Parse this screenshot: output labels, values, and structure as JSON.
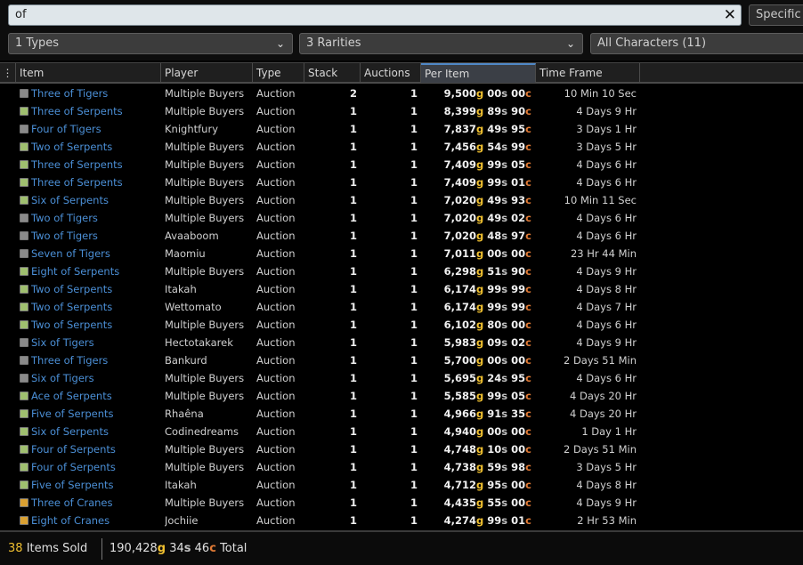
{
  "search": {
    "value": "of",
    "specific_label": "Specific"
  },
  "filters": {
    "types": "1 Types",
    "rarities": "3 Rarities",
    "characters": "All Characters (11)"
  },
  "columns": {
    "menu": "⋮",
    "item": "Item",
    "player": "Player",
    "type": "Type",
    "stack": "Stack",
    "auctions": "Auctions",
    "per_item": "Per Item",
    "time_frame": "Time Frame"
  },
  "rows": [
    {
      "item": "Three of Tigers",
      "player": "Multiple Buyers",
      "type": "Auction",
      "stack": "2",
      "auctions": "1",
      "g": "9,500",
      "s": "00",
      "c": "00",
      "time": "10 Min 10 Sec",
      "icon_color": "#8a8a8a"
    },
    {
      "item": "Three of Serpents",
      "player": "Multiple Buyers",
      "type": "Auction",
      "stack": "1",
      "auctions": "1",
      "g": "8,399",
      "s": "89",
      "c": "90",
      "time": "4 Days 9 Hr",
      "icon_color": "#9fbf6f"
    },
    {
      "item": "Four of Tigers",
      "player": "Knightfury",
      "type": "Auction",
      "stack": "1",
      "auctions": "1",
      "g": "7,837",
      "s": "49",
      "c": "95",
      "time": "3 Days 1 Hr",
      "icon_color": "#8a8a8a"
    },
    {
      "item": "Two of Serpents",
      "player": "Multiple Buyers",
      "type": "Auction",
      "stack": "1",
      "auctions": "1",
      "g": "7,456",
      "s": "54",
      "c": "99",
      "time": "3 Days 5 Hr",
      "icon_color": "#9fbf6f"
    },
    {
      "item": "Three of Serpents",
      "player": "Multiple Buyers",
      "type": "Auction",
      "stack": "1",
      "auctions": "1",
      "g": "7,409",
      "s": "99",
      "c": "05",
      "time": "4 Days 6 Hr",
      "icon_color": "#9fbf6f"
    },
    {
      "item": "Three of Serpents",
      "player": "Multiple Buyers",
      "type": "Auction",
      "stack": "1",
      "auctions": "1",
      "g": "7,409",
      "s": "99",
      "c": "01",
      "time": "4 Days 6 Hr",
      "icon_color": "#9fbf6f"
    },
    {
      "item": "Six of Serpents",
      "player": "Multiple Buyers",
      "type": "Auction",
      "stack": "1",
      "auctions": "1",
      "g": "7,020",
      "s": "49",
      "c": "93",
      "time": "10 Min 11 Sec",
      "icon_color": "#9fbf6f"
    },
    {
      "item": "Two of Tigers",
      "player": "Multiple Buyers",
      "type": "Auction",
      "stack": "1",
      "auctions": "1",
      "g": "7,020",
      "s": "49",
      "c": "02",
      "time": "4 Days 6 Hr",
      "icon_color": "#8a8a8a"
    },
    {
      "item": "Two of Tigers",
      "player": "Avaaboom",
      "type": "Auction",
      "stack": "1",
      "auctions": "1",
      "g": "7,020",
      "s": "48",
      "c": "97",
      "time": "4 Days 6 Hr",
      "icon_color": "#8a8a8a"
    },
    {
      "item": "Seven of Tigers",
      "player": "Maomiu",
      "type": "Auction",
      "stack": "1",
      "auctions": "1",
      "g": "7,011",
      "s": "00",
      "c": "00",
      "time": "23 Hr 44 Min",
      "icon_color": "#8a8a8a"
    },
    {
      "item": "Eight of Serpents",
      "player": "Multiple Buyers",
      "type": "Auction",
      "stack": "1",
      "auctions": "1",
      "g": "6,298",
      "s": "51",
      "c": "90",
      "time": "4 Days 9 Hr",
      "icon_color": "#9fbf6f"
    },
    {
      "item": "Two of Serpents",
      "player": "Itakah",
      "type": "Auction",
      "stack": "1",
      "auctions": "1",
      "g": "6,174",
      "s": "99",
      "c": "99",
      "time": "4 Days 8 Hr",
      "icon_color": "#9fbf6f"
    },
    {
      "item": "Two of Serpents",
      "player": "Wettomato",
      "type": "Auction",
      "stack": "1",
      "auctions": "1",
      "g": "6,174",
      "s": "99",
      "c": "99",
      "time": "4 Days 7 Hr",
      "icon_color": "#9fbf6f"
    },
    {
      "item": "Two of Serpents",
      "player": "Multiple Buyers",
      "type": "Auction",
      "stack": "1",
      "auctions": "1",
      "g": "6,102",
      "s": "80",
      "c": "00",
      "time": "4 Days 6 Hr",
      "icon_color": "#9fbf6f"
    },
    {
      "item": "Six of Tigers",
      "player": "Hectotakarek",
      "type": "Auction",
      "stack": "1",
      "auctions": "1",
      "g": "5,983",
      "s": "09",
      "c": "02",
      "time": "4 Days 9 Hr",
      "icon_color": "#8a8a8a"
    },
    {
      "item": "Three of Tigers",
      "player": "Bankurd",
      "type": "Auction",
      "stack": "1",
      "auctions": "1",
      "g": "5,700",
      "s": "00",
      "c": "00",
      "time": "2 Days 51 Min",
      "icon_color": "#8a8a8a"
    },
    {
      "item": "Six of Tigers",
      "player": "Multiple Buyers",
      "type": "Auction",
      "stack": "1",
      "auctions": "1",
      "g": "5,695",
      "s": "24",
      "c": "95",
      "time": "4 Days 6 Hr",
      "icon_color": "#8a8a8a"
    },
    {
      "item": "Ace of Serpents",
      "player": "Multiple Buyers",
      "type": "Auction",
      "stack": "1",
      "auctions": "1",
      "g": "5,585",
      "s": "99",
      "c": "05",
      "time": "4 Days 20 Hr",
      "icon_color": "#9fbf6f"
    },
    {
      "item": "Five of Serpents",
      "player": "Rhaêna",
      "type": "Auction",
      "stack": "1",
      "auctions": "1",
      "g": "4,966",
      "s": "91",
      "c": "35",
      "time": "4 Days 20 Hr",
      "icon_color": "#9fbf6f"
    },
    {
      "item": "Six of Serpents",
      "player": "Codinedreams",
      "type": "Auction",
      "stack": "1",
      "auctions": "1",
      "g": "4,940",
      "s": "00",
      "c": "00",
      "time": "1 Day 1 Hr",
      "icon_color": "#9fbf6f"
    },
    {
      "item": "Four of Serpents",
      "player": "Multiple Buyers",
      "type": "Auction",
      "stack": "1",
      "auctions": "1",
      "g": "4,748",
      "s": "10",
      "c": "00",
      "time": "2 Days 51 Min",
      "icon_color": "#9fbf6f"
    },
    {
      "item": "Four of Serpents",
      "player": "Multiple Buyers",
      "type": "Auction",
      "stack": "1",
      "auctions": "1",
      "g": "4,738",
      "s": "59",
      "c": "98",
      "time": "3 Days 5 Hr",
      "icon_color": "#9fbf6f"
    },
    {
      "item": "Five of Serpents",
      "player": "Itakah",
      "type": "Auction",
      "stack": "1",
      "auctions": "1",
      "g": "4,712",
      "s": "95",
      "c": "00",
      "time": "4 Days 8 Hr",
      "icon_color": "#9fbf6f"
    },
    {
      "item": "Three of Cranes",
      "player": "Multiple Buyers",
      "type": "Auction",
      "stack": "1",
      "auctions": "1",
      "g": "4,435",
      "s": "55",
      "c": "00",
      "time": "4 Days 9 Hr",
      "icon_color": "#d9a032"
    },
    {
      "item": "Eight of Cranes",
      "player": "Jochiie",
      "type": "Auction",
      "stack": "1",
      "auctions": "1",
      "g": "4,274",
      "s": "99",
      "c": "01",
      "time": "2 Hr 53 Min",
      "icon_color": "#d9a032"
    }
  ],
  "currency": {
    "gold": "g",
    "silver": "s",
    "copper": "c"
  },
  "footer": {
    "count": "38",
    "count_label": "Items Sold",
    "total_g": "190,428",
    "total_s": "34",
    "total_c": "46",
    "total_label": "Total"
  }
}
